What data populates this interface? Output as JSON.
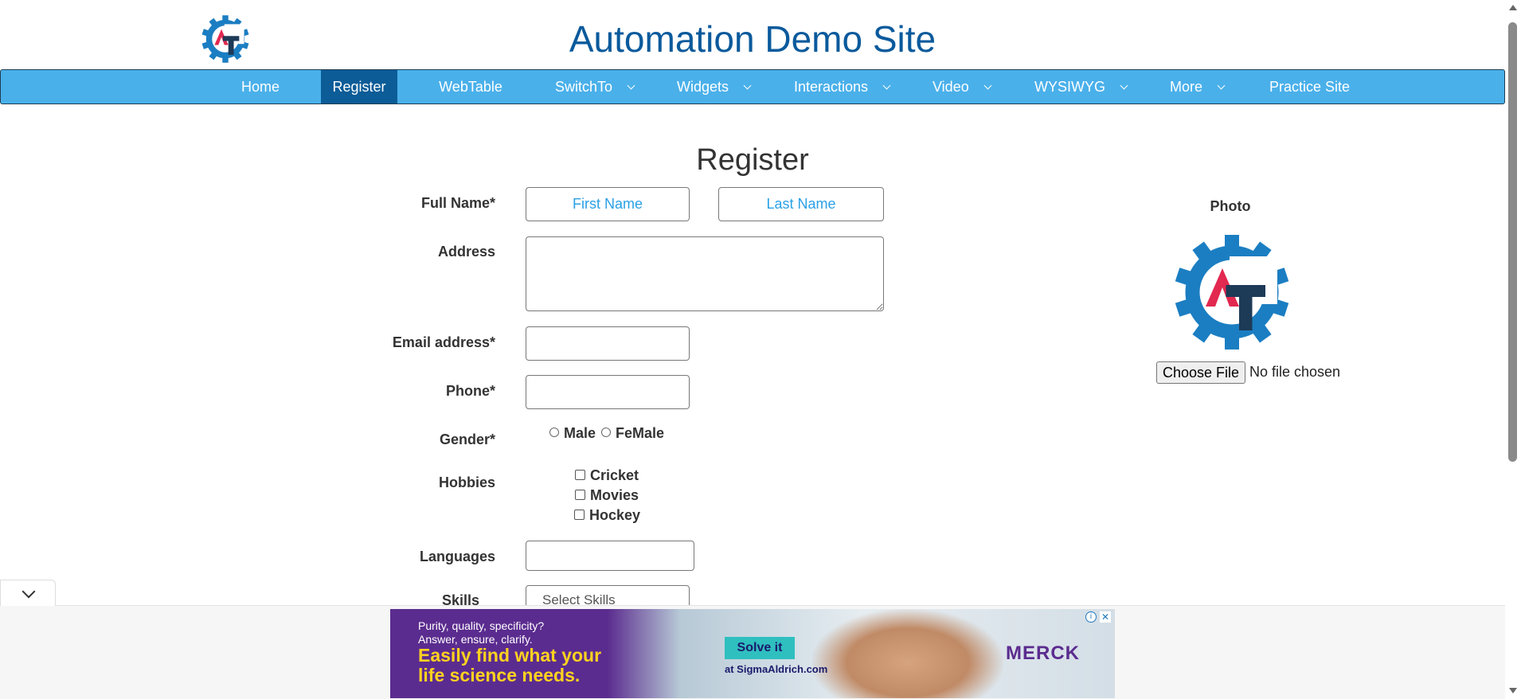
{
  "site": {
    "title": "Automation Demo Site"
  },
  "nav": {
    "items": [
      {
        "label": "Home"
      },
      {
        "label": "Register"
      },
      {
        "label": "WebTable"
      },
      {
        "label": "SwitchTo"
      },
      {
        "label": "Widgets"
      },
      {
        "label": "Interactions"
      },
      {
        "label": "Video"
      },
      {
        "label": "WYSIWYG"
      },
      {
        "label": "More"
      },
      {
        "label": "Practice Site"
      }
    ],
    "active": "Register"
  },
  "form": {
    "heading": "Register",
    "full_name_label": "Full Name*",
    "first_name_placeholder": "First Name",
    "last_name_placeholder": "Last Name",
    "address_label": "Address",
    "address_value": "",
    "email_label": "Email address*",
    "email_value": "",
    "phone_label": "Phone*",
    "phone_value": "",
    "gender_label": "Gender*",
    "gender_options": [
      "Male",
      "FeMale"
    ],
    "hobbies_label": "Hobbies",
    "hobbies": [
      "Cricket",
      "Movies",
      "Hockey"
    ],
    "languages_label": "Languages",
    "languages_value": "",
    "skills_label": "Skills",
    "skills_selected": "Select Skills"
  },
  "photo": {
    "label": "Photo",
    "choose_file_label": "Choose File",
    "file_status": "No file chosen"
  },
  "ad": {
    "line1": "Purity, quality, specificity?",
    "line2": "Answer, ensure, clarify.",
    "headline1": "Easily find what your",
    "headline2": "life science needs.",
    "cta": "Solve it",
    "cta_sub": "at SigmaAldrich.com",
    "brand": "MERCK",
    "info_icon": "i",
    "close_icon": "✕"
  },
  "colors": {
    "nav_bg": "#4ab0ea",
    "nav_active_bg": "#0c5c98",
    "title_color": "#0a5a9c",
    "placeholder_color": "#2aa0e6",
    "logo_gear": "#1b7ec2",
    "logo_a": "#e22950",
    "logo_t": "#1d3a57"
  }
}
